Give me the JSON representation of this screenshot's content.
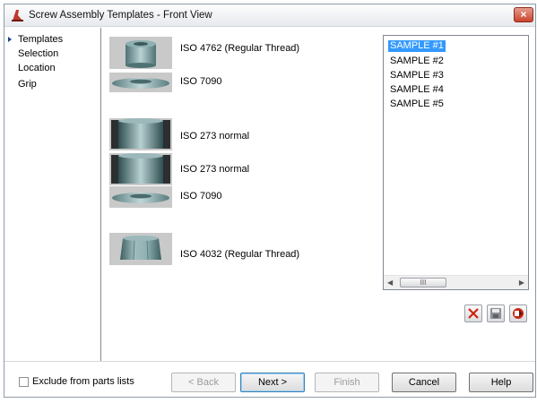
{
  "window": {
    "title": "Screw Assembly Templates - Front View",
    "close_glyph": "×"
  },
  "nav": {
    "items": [
      {
        "label": "Templates",
        "active": true
      },
      {
        "label": "Selection",
        "active": false
      },
      {
        "label": "Location",
        "active": false
      },
      {
        "label": "Grip",
        "active": false
      }
    ]
  },
  "parts": [
    {
      "label": "ISO 4762  (Regular Thread)",
      "icon": "socket-head-cap-screw-icon"
    },
    {
      "label": "ISO 7090",
      "icon": "washer-icon"
    },
    {
      "label": "ISO 273 normal",
      "icon": "through-hole-icon"
    },
    {
      "label": "ISO 273 normal",
      "icon": "through-hole-icon"
    },
    {
      "label": "ISO 7090",
      "icon": "washer-icon"
    },
    {
      "label": "ISO 4032  (Regular Thread)",
      "icon": "hex-nut-icon"
    }
  ],
  "templates_list": {
    "items": [
      "SAMPLE #1",
      "SAMPLE #2",
      "SAMPLE #3",
      "SAMPLE #4",
      "SAMPLE #5"
    ],
    "selected": "SAMPLE #1",
    "scroll_thumb_glyph": "III",
    "scroll_left_glyph": "◀",
    "scroll_right_glyph": "▶"
  },
  "toolbar": {
    "delete_icon": "delete-x-icon",
    "save_icon": "save-icon",
    "publish_icon": "publish-icon"
  },
  "footer": {
    "exclude_label": "Exclude from parts lists",
    "exclude_checked": false,
    "back_label": "< Back",
    "next_label": "Next >",
    "finish_label": "Finish",
    "cancel_label": "Cancel",
    "help_label": "Help"
  },
  "colors": {
    "selection": "#3399ff",
    "nav_arrow": "#1c3f93",
    "delete_red": "#cc2211",
    "thumb_bg": "#c9c9c9",
    "metal": "#7fa3a5"
  }
}
